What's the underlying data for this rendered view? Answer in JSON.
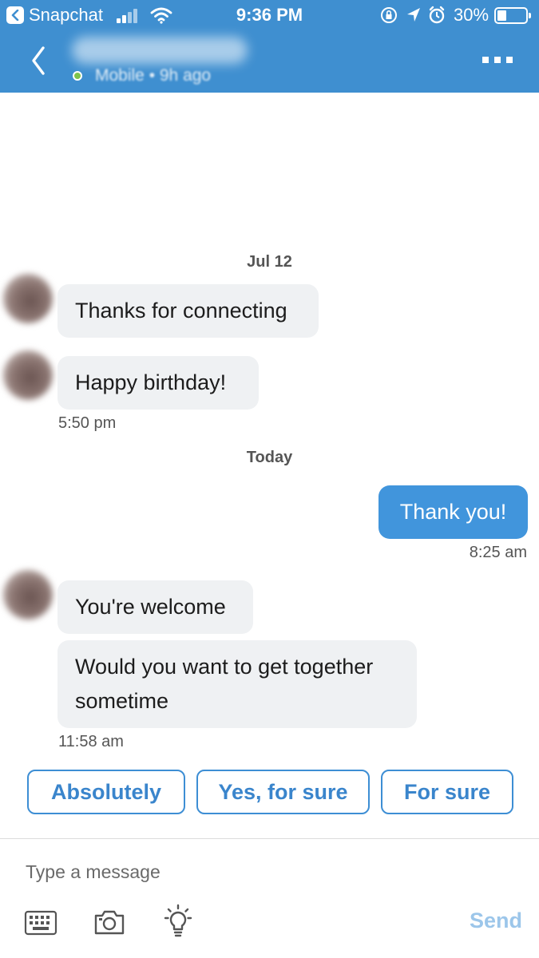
{
  "status_bar": {
    "back_app": "Snapchat",
    "time": "9:36 PM",
    "battery": "30%"
  },
  "header": {
    "status_text": "Mobile • 9h ago",
    "name_obscured": true
  },
  "conversation": {
    "groups": [
      {
        "date": "Jul 12",
        "messages": [
          {
            "sender": "contact",
            "text": "Thanks for connecting"
          },
          {
            "sender": "contact",
            "text": "Happy birthday!",
            "time": "5:50 pm"
          }
        ]
      },
      {
        "date": "Today",
        "messages": [
          {
            "sender": "me",
            "text": "Thank you!",
            "time": "8:25 am"
          },
          {
            "sender": "contact",
            "text": "You're welcome"
          },
          {
            "sender": "contact",
            "text": "Would you want to get together sometime",
            "time": "11:58 am"
          }
        ]
      }
    ]
  },
  "quick_replies": [
    "Absolutely",
    "Yes, for sure",
    "For sure"
  ],
  "composer": {
    "placeholder": "Type a message",
    "send_label": "Send",
    "icons": [
      "keyboard-icon",
      "camera-icon",
      "lightbulb-icon"
    ]
  },
  "colors": {
    "header": "#3f8fd0",
    "own_bubble": "#4195dc",
    "other_bubble": "#eff1f3",
    "accent": "#3d8ed4",
    "send_disabled": "#9cc6ea"
  }
}
